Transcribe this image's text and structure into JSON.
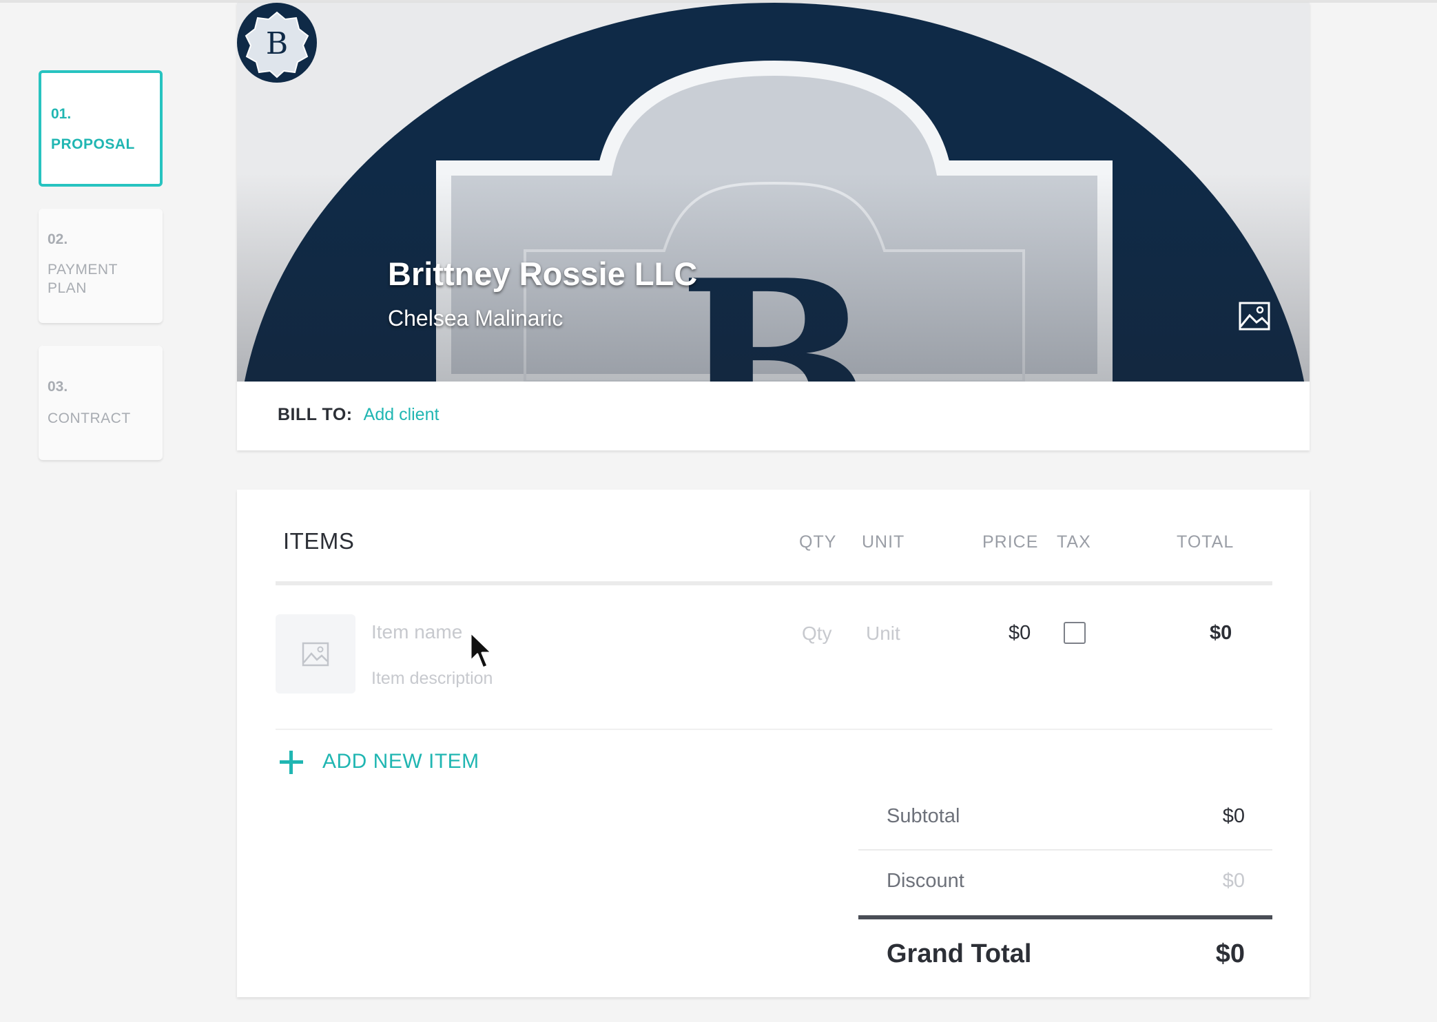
{
  "steps": [
    {
      "num": "01.",
      "label": "PROPOSAL",
      "active": true
    },
    {
      "num": "02.",
      "label": "PAYMENT PLAN",
      "active": false
    },
    {
      "num": "03.",
      "label": "CONTRACT",
      "active": false
    }
  ],
  "header": {
    "logo_letter": "B",
    "banner_letter": "B",
    "company_name": "Brittney Rossie LLC",
    "contact_name": "Chelsea Malinaric",
    "change_image_icon": "image-icon"
  },
  "bill_to": {
    "label": "BILL TO:",
    "link": "Add client"
  },
  "items": {
    "title": "ITEMS",
    "columns": {
      "qty": "QTY",
      "unit": "UNIT",
      "price": "PRICE",
      "tax": "TAX",
      "total": "TOTAL"
    },
    "row": {
      "name_placeholder": "Item name",
      "description_placeholder": "Item description",
      "qty_placeholder": "Qty",
      "unit_placeholder": "Unit",
      "price": "$0",
      "tax_checked": false,
      "total": "$0"
    },
    "add_item_label": "ADD NEW ITEM"
  },
  "summary": {
    "subtotal_label": "Subtotal",
    "subtotal_value": "$0",
    "discount_label": "Discount",
    "discount_value": "$0",
    "grand_total_label": "Grand Total",
    "grand_total_value": "$0"
  },
  "colors": {
    "accent": "#20b6b2",
    "navy": "#0f2a47",
    "text": "#2c2f36"
  }
}
